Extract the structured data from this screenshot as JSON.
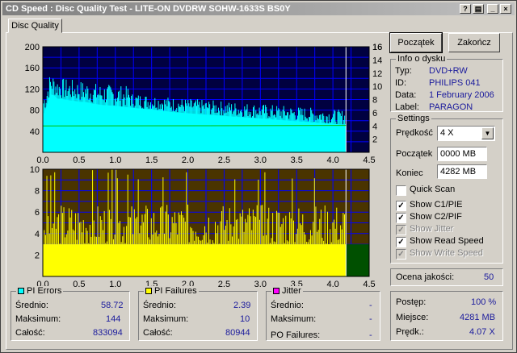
{
  "window": {
    "title": "CD Speed : Disc Quality Test - LITE-ON DVDRW SOHW-1633S BS0Y",
    "tab_label": "Disc Quality"
  },
  "buttons": {
    "start": "Początek",
    "close": "Zakończ"
  },
  "disc_info": {
    "title": "Info o dysku",
    "type_label": "Typ:",
    "type_value": "DVD+RW",
    "id_label": "ID:",
    "id_value": "PHILIPS 041",
    "date_label": "Data:",
    "date_value": "1 February 2006",
    "label_label": "Label:",
    "label_value": "PARAGON"
  },
  "settings": {
    "title": "Settings",
    "speed_label": "Prędkość",
    "speed_value": "4 X",
    "start_label": "Początek",
    "start_value": "0000 MB",
    "end_label": "Koniec",
    "end_value": "4282 MB",
    "quick_scan": "Quick Scan",
    "show_c1": "Show C1/PIE",
    "show_c2": "Show C2/PIF",
    "show_jitter": "Show Jitter",
    "show_read": "Show Read Speed",
    "show_write": "Show Write Speed"
  },
  "quality": {
    "label": "Ocena jakości:",
    "value": "50"
  },
  "progress": {
    "progress_label": "Postęp:",
    "progress_value": "100 %",
    "location_label": "Miejsce:",
    "location_value": "4281 MB",
    "speed_label": "Prędk.:",
    "speed_value": "4.07 X"
  },
  "pi_errors": {
    "title": "PI Errors",
    "avg_label": "Średnio:",
    "avg_value": "58.72",
    "max_label": "Maksimum:",
    "max_value": "144",
    "total_label": "Całość:",
    "total_value": "833094"
  },
  "pi_failures": {
    "title": "PI Failures",
    "avg_label": "Średnio:",
    "avg_value": "2.39",
    "max_label": "Maksimum:",
    "max_value": "10",
    "total_label": "Całość:",
    "total_value": "80944"
  },
  "jitter": {
    "title": "Jitter",
    "avg_label": "Średnio:",
    "avg_value": "-",
    "max_label": "Maksimum:",
    "max_value": "-",
    "po_label": "PO Failures:",
    "po_value": "-"
  },
  "colors": {
    "pi_errors": "#00ffff",
    "pi_failures": "#ffff00",
    "jitter": "#ff00ff",
    "plot_bg_top": "#000040",
    "plot_bg_bottom": "#4a3400",
    "grid": "#0000ff",
    "read_speed": "#00c000",
    "end_region": "#005000"
  },
  "chart_data": [
    {
      "type": "area",
      "series": [
        {
          "name": "PI Errors",
          "x": [
            0.0,
            0.05,
            0.1,
            0.15,
            0.2,
            0.3,
            0.4,
            0.5,
            0.6,
            0.7,
            0.8,
            0.9,
            1.0,
            1.2,
            1.4,
            1.6,
            1.8,
            2.0,
            2.2,
            2.4,
            2.6,
            2.8,
            3.0,
            3.2,
            3.4,
            3.6,
            3.8,
            4.0,
            4.18
          ],
          "y": [
            70,
            85,
            110,
            108,
            102,
            100,
            98,
            96,
            95,
            92,
            90,
            89,
            88,
            85,
            82,
            80,
            76,
            74,
            72,
            70,
            68,
            66,
            64,
            62,
            60,
            58,
            56,
            54,
            52
          ]
        },
        {
          "name": "Read Speed",
          "x": [
            0.0,
            4.18
          ],
          "y": [
            4.0,
            4.07
          ]
        }
      ],
      "xticks": [
        "0.0",
        "0.5",
        "1.0",
        "1.5",
        "2.0",
        "2.5",
        "3.0",
        "3.5",
        "4.0",
        "4.5"
      ],
      "yticks_left": [
        "40",
        "80",
        "120",
        "160",
        "200"
      ],
      "yticks_right": [
        "2",
        "4",
        "6",
        "8",
        "10",
        "12",
        "14",
        "16"
      ],
      "xlim": [
        0,
        4.5
      ],
      "ylim": [
        0,
        200
      ],
      "y2lim": [
        0,
        16
      ],
      "grid": true
    },
    {
      "type": "bar",
      "series": [
        {
          "name": "PI Failures",
          "x": [
            0.0,
            0.5,
            1.0,
            1.5,
            2.0,
            2.5,
            3.0,
            3.5,
            4.0,
            4.18
          ],
          "y": [
            3,
            3,
            3,
            3,
            3,
            3,
            3,
            3,
            3,
            3
          ]
        }
      ],
      "xticks": [
        "0.0",
        "0.5",
        "1.0",
        "1.5",
        "2.0",
        "2.5",
        "3.0",
        "3.5",
        "4.0",
        "4.5"
      ],
      "yticks": [
        "2",
        "4",
        "6",
        "8",
        "10"
      ],
      "xlim": [
        0,
        4.5
      ],
      "ylim": [
        0,
        10
      ],
      "grid": true
    }
  ]
}
